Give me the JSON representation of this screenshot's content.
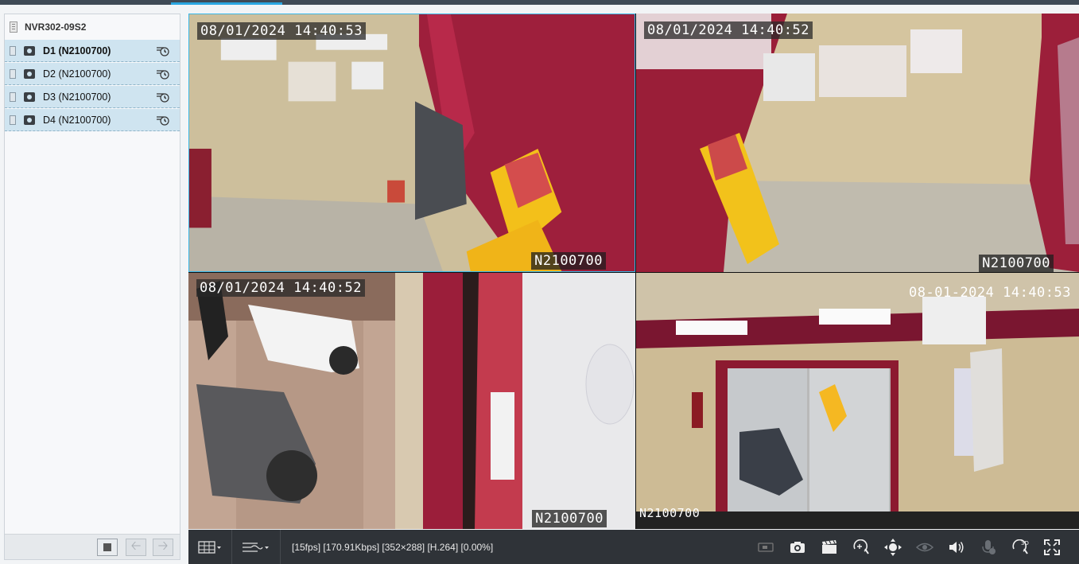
{
  "device": {
    "name": "NVR302-09S2"
  },
  "channels": [
    {
      "label": "D1 (N2100700)",
      "active": true
    },
    {
      "label": "D2 (N2100700)",
      "active": false
    },
    {
      "label": "D3 (N2100700)",
      "active": false
    },
    {
      "label": "D4 (N2100700)",
      "active": false
    }
  ],
  "tiles": [
    {
      "timestamp": "08/01/2024 14:40:53",
      "name": "N2100700"
    },
    {
      "timestamp": "08/01/2024 14:40:52",
      "name": "N2100700"
    },
    {
      "timestamp": "08/01/2024 14:40:52",
      "name": "N2100700"
    },
    {
      "timestamp": "08-01-2024 14:40:53",
      "name": "N2100700"
    }
  ],
  "toolbar": {
    "stats": "[15fps] [170.91Kbps] [352×288] [H.264] [0.00%]",
    "icons": [
      "layout-grid-icon",
      "stream-icon",
      "record-clip-icon",
      "snapshot-icon",
      "clip-icon",
      "digital-zoom-icon",
      "ptz-icon",
      "fisheye-icon",
      "volume-icon",
      "talk-icon",
      "3d-zoom-icon",
      "fullscreen-icon"
    ]
  },
  "colors": {
    "accent": "#2aa6e0",
    "selected_row": "#cfe4f0",
    "toolbar": "#2f3338"
  }
}
